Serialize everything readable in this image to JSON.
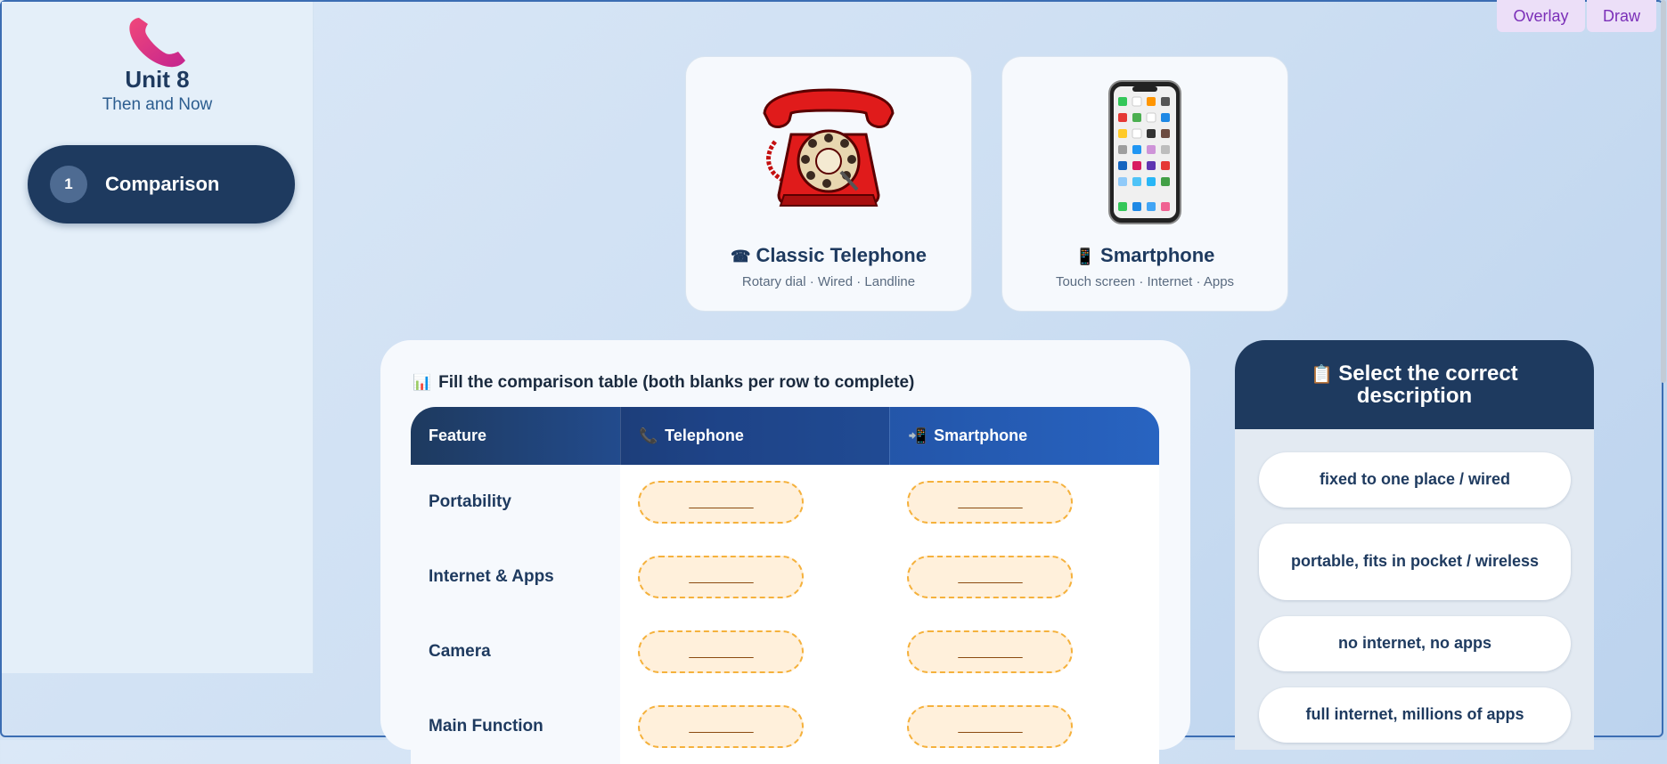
{
  "sidebar": {
    "unit_title": "Unit 8",
    "unit_subtitle": "Then and Now",
    "logo_icon": "telephone-receiver-icon",
    "nav": [
      {
        "number": "1",
        "label": "Comparison"
      }
    ]
  },
  "toolbar": {
    "overlay_label": "Overlay",
    "draw_label": "Draw"
  },
  "cards": {
    "telephone": {
      "icon": "☎",
      "title": "Classic Telephone",
      "desc": "Rotary dial · Wired · Landline"
    },
    "smartphone": {
      "icon": "📱",
      "title": "Smartphone",
      "desc": "Touch screen · Internet · Apps"
    }
  },
  "table": {
    "instruction_icon": "📊",
    "instruction": "Fill the comparison table (both blanks per row to complete)",
    "headers": {
      "feature": "Feature",
      "telephone": "Telephone",
      "smartphone": "Smartphone"
    },
    "header_icons": {
      "telephone": "📞",
      "smartphone": "📲"
    },
    "blank_text": "_________",
    "rows": [
      {
        "feature": "Portability"
      },
      {
        "feature": "Internet & Apps"
      },
      {
        "feature": "Camera"
      },
      {
        "feature": "Main Function"
      }
    ]
  },
  "select": {
    "icon": "📋",
    "title": "Select the correct description",
    "options": [
      "fixed to one place / wired",
      "portable, fits in pocket / wireless",
      "no internet, no apps",
      "full internet, millions of apps"
    ]
  },
  "colors": {
    "navy": "#1e3a5f",
    "accent_purple": "#7b2fb8",
    "blank_border": "#f5b13c",
    "blank_fill": "#fff0db"
  }
}
